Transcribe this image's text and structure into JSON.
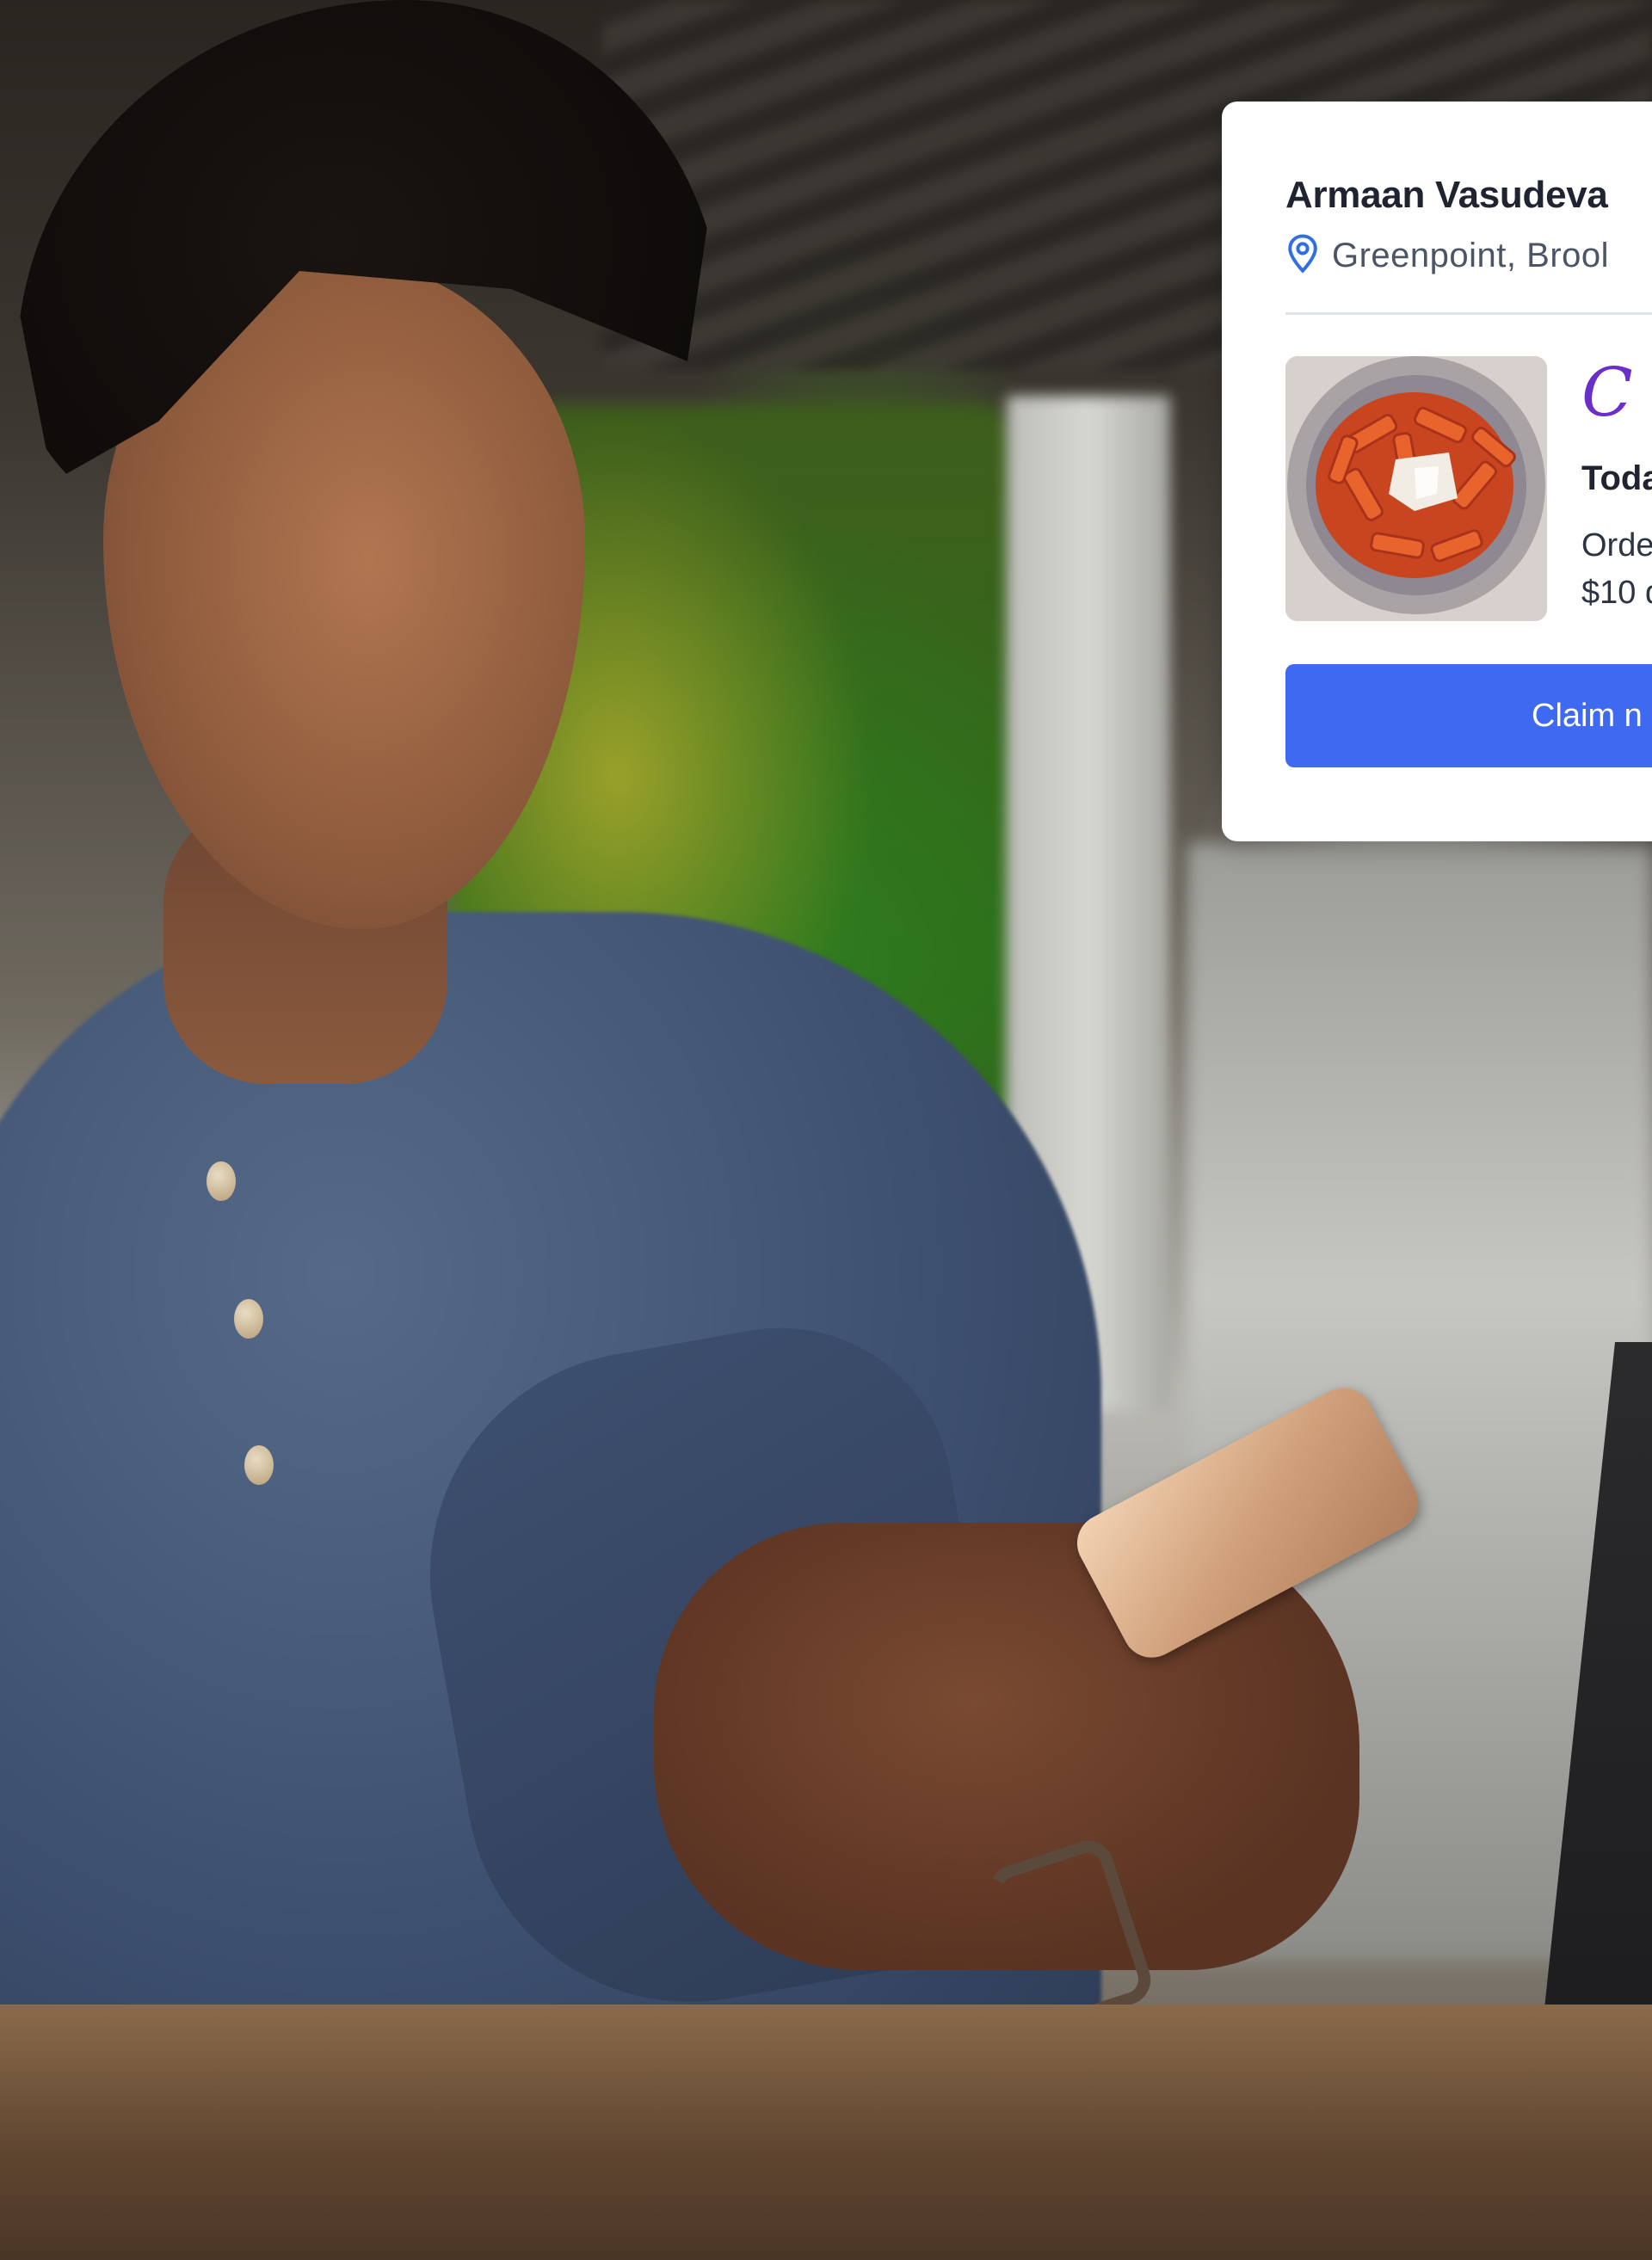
{
  "card": {
    "user_name": "Armaan Vasudeva",
    "location": "Greenpoint, Brool",
    "location_icon": "map-pin-icon",
    "offer": {
      "image": "penne-pasta-dish",
      "restaurant_logo_text": "C",
      "title": "Toda",
      "description_line1": "Orde",
      "description_line2": "$10 d"
    },
    "claim_button_label": "Claim n"
  },
  "colors": {
    "accent_button": "#3d6af0",
    "pin_icon": "#2f6fe4",
    "logo": "#6b2fc9",
    "text_primary": "#1f2430",
    "text_secondary": "#4b5566"
  }
}
